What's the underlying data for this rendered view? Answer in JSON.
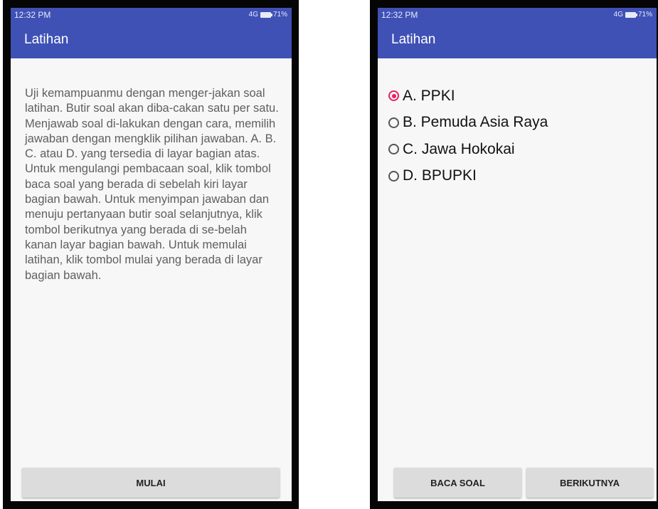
{
  "colors": {
    "primary": "#3f51b5",
    "accent": "#e91e63",
    "background": "#f7f7f7"
  },
  "left_screen": {
    "status_time": "12:32 PM",
    "status_icons": "4G",
    "battery_text": "71%",
    "app_title": "Latihan",
    "instructions": "Uji kemampuanmu dengan menger-jakan soal latihan. Butir soal akan diba-cakan satu per satu. Menjawab soal di-lakukan dengan cara, memilih jawaban dengan mengklik pilihan jawaban. A. B. C. atau D. yang tersedia di layar bagian atas. Untuk mengulangi pembacaan soal, klik tombol baca soal yang berada di sebelah kiri layar bagian bawah. Untuk menyimpan jawaban dan menuju pertanyaan butir soal selanjutnya, klik tombol berikutnya yang berada di se-belah kanan layar bagian bawah. Untuk memulai latihan, klik tombol mulai yang berada di layar bagian bawah.",
    "start_button": "MULAI"
  },
  "right_screen": {
    "status_time": "12:32 PM",
    "status_icons": "4G",
    "battery_text": "71%",
    "app_title": "Latihan",
    "options": [
      {
        "label": "A. PPKI",
        "selected": true
      },
      {
        "label": "B. Pemuda Asia Raya",
        "selected": false
      },
      {
        "label": "C. Jawa Hokokai",
        "selected": false
      },
      {
        "label": "D. BPUPKI",
        "selected": false
      }
    ],
    "read_button": "BACA SOAL",
    "next_button": "BERIKUTNYA"
  }
}
